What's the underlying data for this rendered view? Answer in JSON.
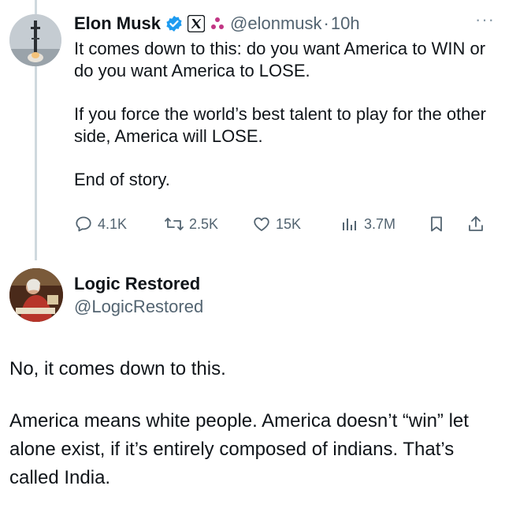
{
  "tweet1": {
    "name": "Elon Musk",
    "handle": "@elonmusk",
    "separator": "·",
    "time": "10h",
    "more": "···",
    "paragraphs": [
      "It comes down to this: do you want America to WIN or do you want America to LOSE.",
      "If you force the world’s best talent to play for the other side, America will LOSE.",
      "End of story."
    ],
    "stats": {
      "replies": "4.1K",
      "reposts": "2.5K",
      "likes": "15K",
      "views": "3.7M"
    },
    "icons": {
      "verified": "verified-badge-icon",
      "x_logo": "x-logo-icon",
      "affiliation": "affiliation-icon"
    }
  },
  "tweet2": {
    "name": "Logic Restored",
    "handle": "@LogicRestored",
    "paragraphs": [
      "No, it comes down to this.",
      "America means white people. America doesn’t “win” let alone exist, if it’s entirely composed of indians. That’s called India."
    ]
  },
  "colors": {
    "text": "#0f1419",
    "muted": "#536471",
    "verified": "#1d9bf0",
    "thread_line": "#cfd9de",
    "affiliation": "#c13584"
  }
}
